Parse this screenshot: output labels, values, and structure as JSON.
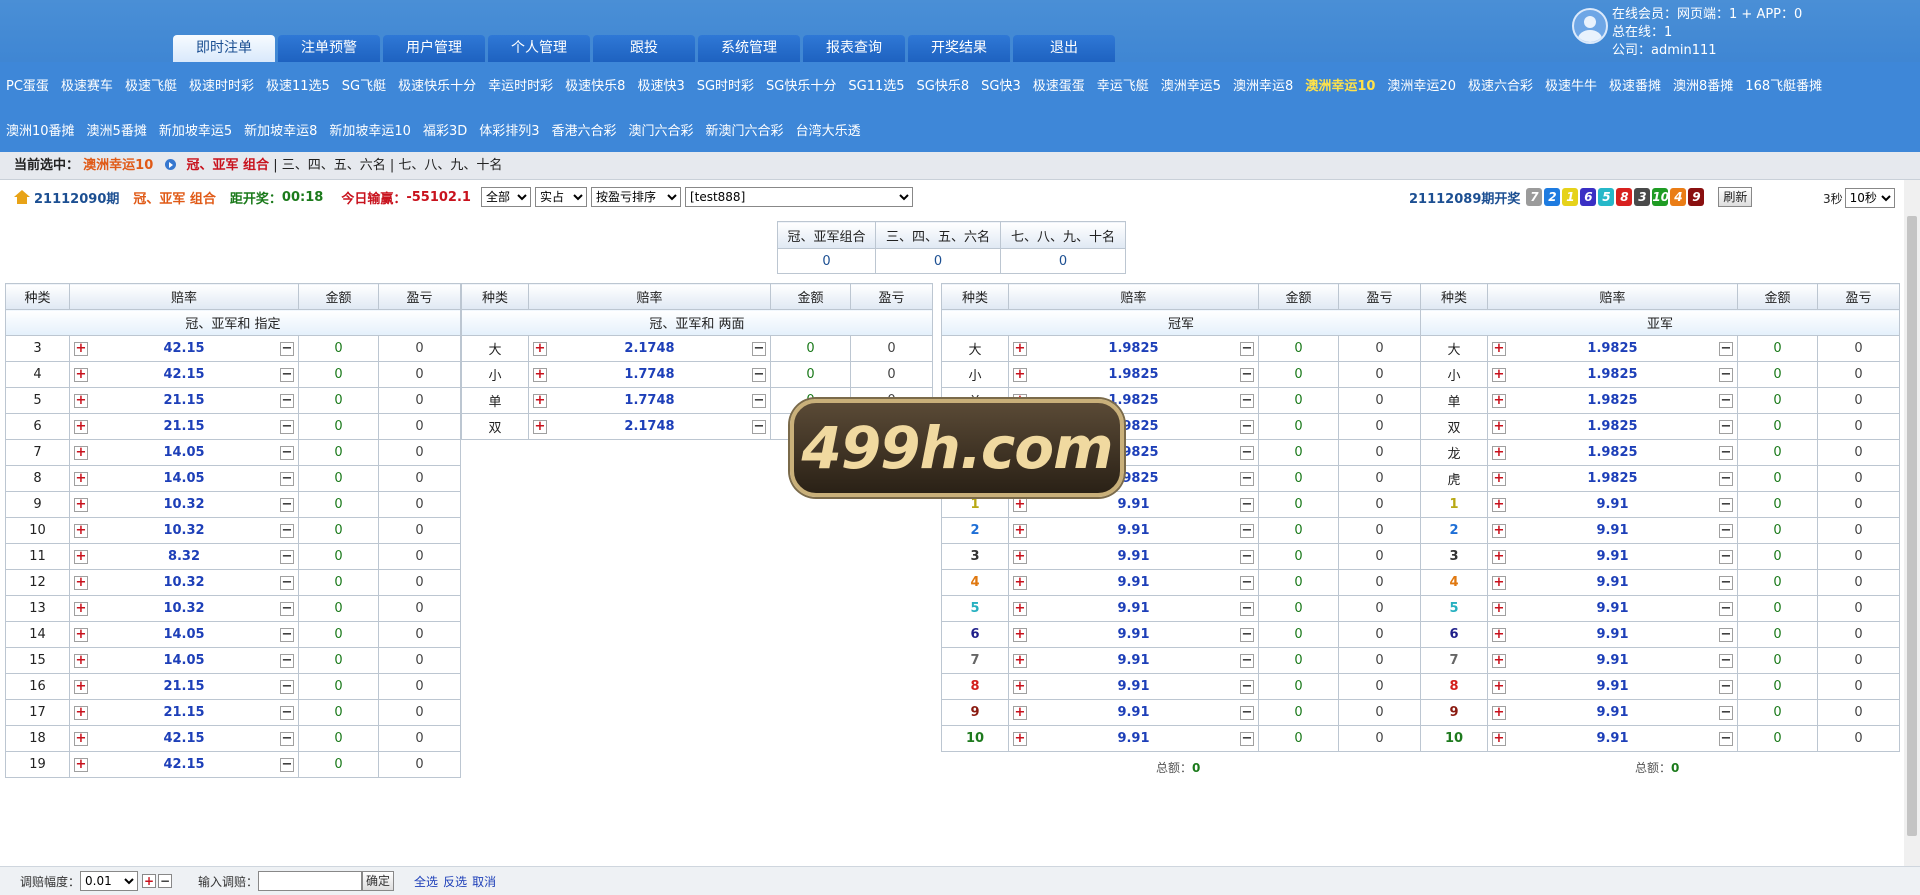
{
  "header": {
    "tabs": [
      "即时注单",
      "注单预警",
      "用户管理",
      "个人管理",
      "跟投",
      "系统管理",
      "报表查询",
      "开奖结果",
      "退出"
    ],
    "active_tab": 0,
    "user": {
      "online_label": "在线会员：",
      "online_value": "网页端：1 + APP：0",
      "total_label": "总在线：",
      "total_value": "1",
      "company_label": "公司：",
      "company_value": "admin111"
    }
  },
  "games": {
    "row1": [
      "PC蛋蛋",
      "极速赛车",
      "极速飞艇",
      "极速时时彩",
      "极速11选5",
      "SG飞艇",
      "极速快乐十分",
      "幸运时时彩",
      "极速快乐8",
      "极速快3",
      "SG时时彩",
      "SG快乐十分",
      "SG11选5",
      "SG快乐8",
      "SG快3",
      "极速蛋蛋",
      "幸运飞艇",
      "澳洲幸运5",
      "澳洲幸运8",
      "澳洲幸运10",
      "澳洲幸运20",
      "极速六合彩",
      "极速牛牛",
      "极速番摊",
      "澳洲8番摊",
      "168飞艇番摊"
    ],
    "row2": [
      "澳洲10番摊",
      "澳洲5番摊",
      "新加坡幸运5",
      "新加坡幸运8",
      "新加坡幸运10",
      "福彩3D",
      "体彩排列3",
      "香港六合彩",
      "澳门六合彩",
      "新澳门六合彩",
      "台湾大乐透"
    ],
    "active": "澳洲幸运10"
  },
  "status": {
    "label": "当前选中：",
    "current": "澳洲幸运10",
    "selected": "冠、亚军 组合",
    "rest": " | 三、四、五、六名 | 七、八、九、十名"
  },
  "info": {
    "period": "21112090期",
    "combo": "冠、亚军 组合",
    "countdown_label": "距开奖：",
    "countdown": "00:18",
    "today_label": "今日输赢：",
    "today_value": "-55102.1",
    "filter1": "全部",
    "filter2": "实占",
    "sort": "按盈亏排序",
    "user": "[test888]"
  },
  "draw": {
    "label": "21112089期开奖",
    "balls": [
      {
        "n": "7",
        "color": "#9b9b9b"
      },
      {
        "n": "2",
        "color": "#1e7be0"
      },
      {
        "n": "1",
        "color": "#e6d21a"
      },
      {
        "n": "6",
        "color": "#3a2fc4"
      },
      {
        "n": "5",
        "color": "#26b8c9"
      },
      {
        "n": "8",
        "color": "#d8211f"
      },
      {
        "n": "3",
        "color": "#4a4a4a"
      },
      {
        "n": "10",
        "color": "#1f9c24"
      },
      {
        "n": "4",
        "color": "#ea7d16"
      },
      {
        "n": "9",
        "color": "#8a1010"
      }
    ],
    "refresh": "刷新",
    "secs_label": "3秒",
    "secs_select": "10秒"
  },
  "summary": {
    "headers": [
      "冠、亚军组合",
      "三、四、五、六名",
      "七、八、九、十名"
    ],
    "values": [
      "0",
      "0",
      "0"
    ]
  },
  "col_headers": [
    "种类",
    "赔率",
    "金额",
    "盈亏"
  ],
  "groups": [
    {
      "title": "冠、亚军和 指定",
      "rows": [
        {
          "k": "3",
          "o": "42.15",
          "a": "0",
          "p": "0"
        },
        {
          "k": "4",
          "o": "42.15",
          "a": "0",
          "p": "0"
        },
        {
          "k": "5",
          "o": "21.15",
          "a": "0",
          "p": "0"
        },
        {
          "k": "6",
          "o": "21.15",
          "a": "0",
          "p": "0"
        },
        {
          "k": "7",
          "o": "14.05",
          "a": "0",
          "p": "0"
        },
        {
          "k": "8",
          "o": "14.05",
          "a": "0",
          "p": "0"
        },
        {
          "k": "9",
          "o": "10.32",
          "a": "0",
          "p": "0"
        },
        {
          "k": "10",
          "o": "10.32",
          "a": "0",
          "p": "0"
        },
        {
          "k": "11",
          "o": "8.32",
          "a": "0",
          "p": "0"
        },
        {
          "k": "12",
          "o": "10.32",
          "a": "0",
          "p": "0"
        },
        {
          "k": "13",
          "o": "10.32",
          "a": "0",
          "p": "0"
        },
        {
          "k": "14",
          "o": "14.05",
          "a": "0",
          "p": "0"
        },
        {
          "k": "15",
          "o": "14.05",
          "a": "0",
          "p": "0"
        },
        {
          "k": "16",
          "o": "21.15",
          "a": "0",
          "p": "0"
        },
        {
          "k": "17",
          "o": "21.15",
          "a": "0",
          "p": "0"
        },
        {
          "k": "18",
          "o": "42.15",
          "a": "0",
          "p": "0"
        },
        {
          "k": "19",
          "o": "42.15",
          "a": "0",
          "p": "0"
        }
      ]
    },
    {
      "title": "冠、亚军和 两面",
      "rows": [
        {
          "k": "大",
          "o": "2.1748",
          "a": "0",
          "p": "0"
        },
        {
          "k": "小",
          "o": "1.7748",
          "a": "0",
          "p": "0"
        },
        {
          "k": "单",
          "o": "1.7748",
          "a": "0",
          "p": "0"
        },
        {
          "k": "双",
          "o": "2.1748",
          "a": "0",
          "p": "0"
        }
      ]
    },
    {
      "title": "冠军",
      "total_label": "总额：",
      "total": "0",
      "rows": [
        {
          "k": "大",
          "o": "1.9825",
          "a": "0",
          "p": "0"
        },
        {
          "k": "小",
          "o": "1.9825",
          "a": "0",
          "p": "0"
        },
        {
          "k": "单",
          "o": "1.9825",
          "a": "0",
          "p": "0"
        },
        {
          "k": "双",
          "o": "1.9825",
          "a": "0",
          "p": "0"
        },
        {
          "k": "龙",
          "o": "1.9825",
          "a": "0",
          "p": "0"
        },
        {
          "k": "虎",
          "o": "1.9825",
          "a": "0",
          "p": "0"
        },
        {
          "k": "1",
          "o": "9.91",
          "a": "0",
          "p": "0",
          "c": "#b8a814"
        },
        {
          "k": "2",
          "o": "9.91",
          "a": "0",
          "p": "0",
          "c": "#1e6fd6"
        },
        {
          "k": "3",
          "o": "9.91",
          "a": "0",
          "p": "0",
          "c": "#333333"
        },
        {
          "k": "4",
          "o": "9.91",
          "a": "0",
          "p": "0",
          "c": "#e0780f"
        },
        {
          "k": "5",
          "o": "9.91",
          "a": "0",
          "p": "0",
          "c": "#26b0c0"
        },
        {
          "k": "6",
          "o": "9.91",
          "a": "0",
          "p": "0",
          "c": "#1f1f8a"
        },
        {
          "k": "7",
          "o": "9.91",
          "a": "0",
          "p": "0",
          "c": "#666666"
        },
        {
          "k": "8",
          "o": "9.91",
          "a": "0",
          "p": "0",
          "c": "#d3201c"
        },
        {
          "k": "9",
          "o": "9.91",
          "a": "0",
          "p": "0",
          "c": "#8a1a10"
        },
        {
          "k": "10",
          "o": "9.91",
          "a": "0",
          "p": "0",
          "c": "#1e7a1e"
        }
      ]
    },
    {
      "title": "亚军",
      "total_label": "总额：",
      "total": "0",
      "rows": [
        {
          "k": "大",
          "o": "1.9825",
          "a": "0",
          "p": "0"
        },
        {
          "k": "小",
          "o": "1.9825",
          "a": "0",
          "p": "0"
        },
        {
          "k": "单",
          "o": "1.9825",
          "a": "0",
          "p": "0"
        },
        {
          "k": "双",
          "o": "1.9825",
          "a": "0",
          "p": "0"
        },
        {
          "k": "龙",
          "o": "1.9825",
          "a": "0",
          "p": "0"
        },
        {
          "k": "虎",
          "o": "1.9825",
          "a": "0",
          "p": "0"
        },
        {
          "k": "1",
          "o": "9.91",
          "a": "0",
          "p": "0",
          "c": "#b8a814"
        },
        {
          "k": "2",
          "o": "9.91",
          "a": "0",
          "p": "0",
          "c": "#1e6fd6"
        },
        {
          "k": "3",
          "o": "9.91",
          "a": "0",
          "p": "0",
          "c": "#333333"
        },
        {
          "k": "4",
          "o": "9.91",
          "a": "0",
          "p": "0",
          "c": "#e0780f"
        },
        {
          "k": "5",
          "o": "9.91",
          "a": "0",
          "p": "0",
          "c": "#26b0c0"
        },
        {
          "k": "6",
          "o": "9.91",
          "a": "0",
          "p": "0",
          "c": "#1f1f8a"
        },
        {
          "k": "7",
          "o": "9.91",
          "a": "0",
          "p": "0",
          "c": "#666666"
        },
        {
          "k": "8",
          "o": "9.91",
          "a": "0",
          "p": "0",
          "c": "#d3201c"
        },
        {
          "k": "9",
          "o": "9.91",
          "a": "0",
          "p": "0",
          "c": "#8a1a10"
        },
        {
          "k": "10",
          "o": "9.91",
          "a": "0",
          "p": "0",
          "c": "#1e7a1e"
        }
      ]
    }
  ],
  "footer": {
    "adjust_label": "调赔幅度：",
    "adjust_value": "0.01",
    "input_label": "输入调赔：",
    "ok": "确定",
    "select_all": "全选",
    "invert": "反选",
    "cancel": "取消"
  },
  "watermark": "499h.com"
}
